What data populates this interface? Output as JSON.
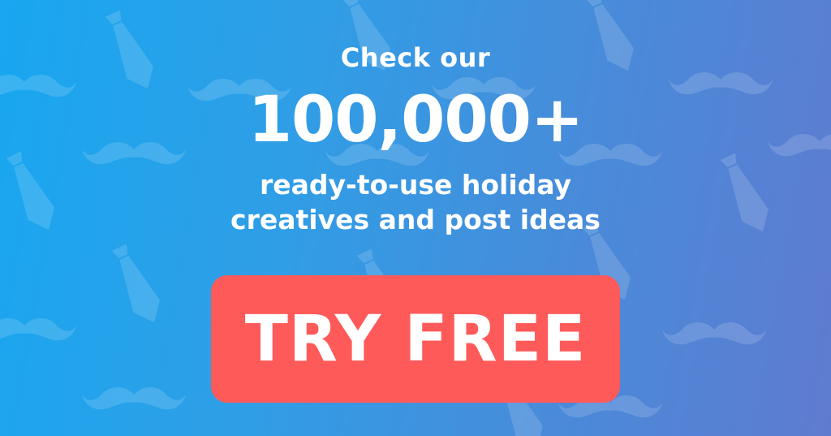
{
  "banner": {
    "line_check": "Check our",
    "line_number": "100,000+",
    "line_sub1": "ready-to-use holiday",
    "line_sub2": "creatives and post ideas",
    "cta_label": "TRY FREE"
  },
  "colors": {
    "gradient_start": "#18a7f0",
    "gradient_end": "#5f7bd0",
    "cta_background": "#ff5a5a",
    "text": "#ffffff",
    "pattern": "#ffffff"
  },
  "pattern_icons": [
    "tie-icon",
    "mustache-icon"
  ]
}
